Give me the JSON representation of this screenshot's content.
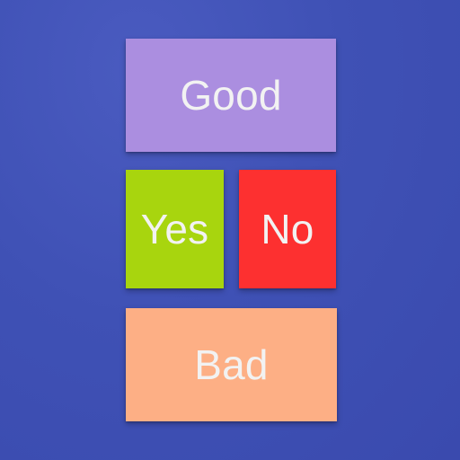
{
  "buttons": {
    "good": {
      "label": "Good",
      "color": "#ab8ee0"
    },
    "yes": {
      "label": "Yes",
      "color": "#a8d50e"
    },
    "no": {
      "label": "No",
      "color": "#fd3030"
    },
    "bad": {
      "label": "Bad",
      "color": "#fdaf85"
    }
  },
  "background_color": "#3f51b5",
  "text_color": "#f2f2f2"
}
